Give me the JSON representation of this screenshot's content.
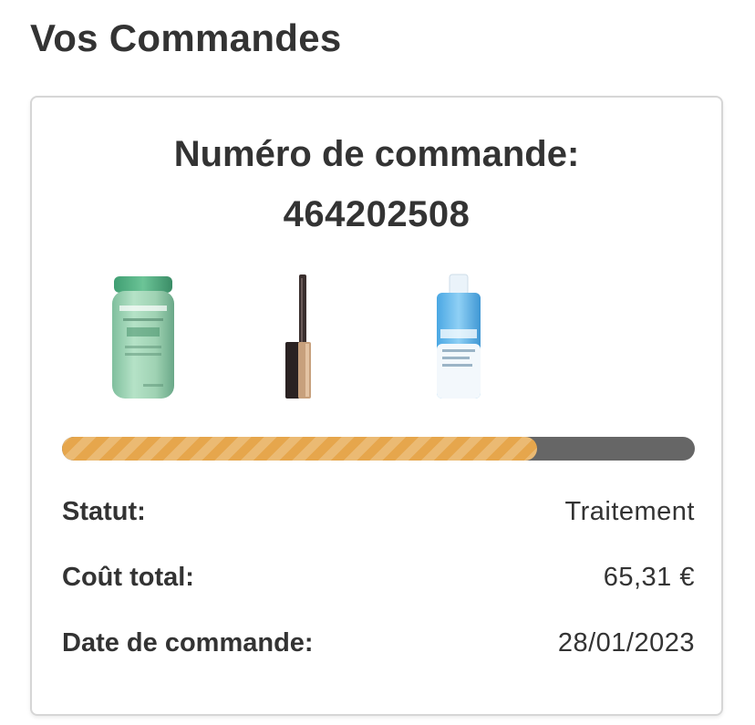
{
  "page": {
    "title": "Vos Commandes"
  },
  "order": {
    "number_label": "Numéro de commande:",
    "number": "464202508",
    "products": [
      {
        "icon": "shampoo-bottle-icon"
      },
      {
        "icon": "eyeshadow-stick-icon"
      },
      {
        "icon": "micellar-water-bottle-icon"
      }
    ],
    "progress": 0.75,
    "progress_color": "#e6a64c",
    "track_color": "#666666",
    "details": {
      "status_label": "Statut:",
      "status_value": "Traitement",
      "total_label": "Coût total:",
      "total_value": "65,31 €",
      "date_label": "Date de commande:",
      "date_value": "28/01/2023"
    }
  }
}
